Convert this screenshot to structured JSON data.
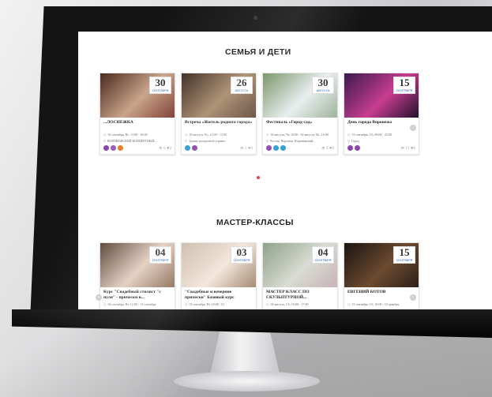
{
  "sections": [
    {
      "title": "СЕМЬЯ И ДЕТИ",
      "cards": [
        {
          "day": "30",
          "month": "сентября",
          "title": "...ЛОСНЕЖКА",
          "time": "30 сентября, Вс, 11:00 - 16:00",
          "place": "ВОРОНЕЖСКИЙ КОНЦЕРТНЫЙ...",
          "stats": "0 ♥0",
          "tags": [
            "#8e44ad",
            "#9b59b6",
            "#e67e22"
          ],
          "colors": [
            "#4a2a1f",
            "#c9a48a",
            "#7d3a2f"
          ]
        },
        {
          "day": "26",
          "month": "августа",
          "title": "Встреча «Житель родного города»",
          "time": "26 августа, Вс, 12:00 - 13:00",
          "place": "Здание концертной управы",
          "stats": "1 ♥0",
          "tags": [
            "#2a9fd6",
            "#8e44ad"
          ],
          "colors": [
            "#3b2a22",
            "#a98b6c",
            "#5c4436"
          ]
        },
        {
          "day": "30",
          "month": "августа",
          "title": "Фестиваль «Город-сад»",
          "time": "30 августа, Чт, 10:00 - 02 августа, Вс, 16:00",
          "place": "Россия, Воронеж, Воронежский...",
          "stats": "0 ♥0",
          "tags": [
            "#8e44ad",
            "#2a9fd6",
            "#2a9fd6"
          ],
          "colors": [
            "#6c8c5a",
            "#e9eef0",
            "#9eb39a"
          ]
        },
        {
          "day": "15",
          "month": "сентября",
          "title": "День города Воронежа",
          "time": "15 сентября, Сб, 00:00 - 22:00",
          "place": "Город",
          "stats": "11 ♥0",
          "tags": [
            "#8e44ad",
            "#8e44ad"
          ],
          "colors": [
            "#3a1a4d",
            "#c73d8f",
            "#22112c"
          ]
        }
      ]
    },
    {
      "title": "МАСТЕР-КЛАССЫ",
      "cards": [
        {
          "day": "04",
          "month": "сентября",
          "title": "Курс \"Свадебный стилист \"с нуля\" - прически и...",
          "time": "04 сентября, Вт, 12:00 - 13 сентября",
          "place": "",
          "stats": "",
          "tags": [],
          "colors": [
            "#5a4536",
            "#e3cfc0",
            "#8a6a55"
          ]
        },
        {
          "day": "03",
          "month": "сентября",
          "title": "\"Свадебные и вечерние прически\" Базовый курс",
          "time": "03 сентября, Вт, 10:00 - 01",
          "place": "",
          "stats": "",
          "tags": [],
          "colors": [
            "#c9b9a7",
            "#f2e6da",
            "#a58b73"
          ]
        },
        {
          "day": "04",
          "month": "сентября",
          "title": "МАСТЕР КЛАСС ПО СКУЛЬПТУРНОЙ...",
          "time": "04 августа, Сб, 10:00 - 17:00",
          "place": "",
          "stats": "",
          "tags": [],
          "colors": [
            "#8fa08a",
            "#d9dcd3",
            "#c8b3b8"
          ]
        },
        {
          "day": "15",
          "month": "сентября",
          "title": "ЕВГЕНИЙ КОТОВ",
          "time": "15 сентября, Сб, 10:00 - 15 декабря",
          "place": "",
          "stats": "",
          "tags": [],
          "colors": [
            "#1a1410",
            "#6b4a30",
            "#2e2018"
          ]
        }
      ]
    }
  ]
}
